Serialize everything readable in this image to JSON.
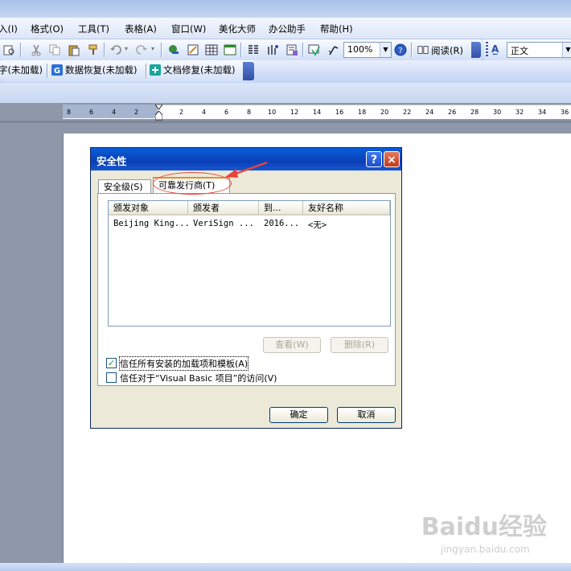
{
  "menubar": {
    "items": [
      "入(I)",
      "格式(O)",
      "工具(T)",
      "表格(A)",
      "窗口(W)",
      "美化大师",
      "办公助手",
      "帮助(H)"
    ]
  },
  "toolbar": {
    "zoom": "100%",
    "reading_label": "阅读(R)",
    "style_value": "正文"
  },
  "toolbar2": {
    "items": [
      "字(未加载)",
      "数据恢复(未加载)",
      "文档修复(未加载)"
    ]
  },
  "ruler": {
    "ticks": [
      "8",
      "6",
      "4",
      "2",
      "2",
      "4",
      "6",
      "8",
      "10",
      "12",
      "14",
      "16",
      "18",
      "20",
      "22",
      "24",
      "26",
      "28",
      "30",
      "32",
      "34",
      "36"
    ]
  },
  "dialog": {
    "title": "安全性",
    "help_symbol": "?",
    "close_symbol": "×",
    "tabs": [
      "安全级(S)",
      "可靠发行商(T)"
    ],
    "columns": [
      "颁发对象",
      "颁发者",
      "到...",
      "友好名称"
    ],
    "rows": [
      [
        "Beijing King...",
        "VeriSign ...",
        "2016...",
        "<无>"
      ]
    ],
    "view_button": "查看(W)",
    "delete_button": "删除(R)",
    "checkbox1_label": "信任所有安装的加载项和模板(A)",
    "checkbox1_checked": true,
    "checkbox2_label": "信任对于“Visual Basic 项目”的访问(V)",
    "checkbox2_checked": false,
    "ok_button": "确定",
    "cancel_button": "取消"
  },
  "watermark": {
    "brand": "Baidu经验",
    "url": "jingyan.baidu.com"
  },
  "colors": {
    "accent_red": "#e8443a",
    "titlebar_blue": "#0a3fb5",
    "dialog_bg": "#ece9d8"
  }
}
